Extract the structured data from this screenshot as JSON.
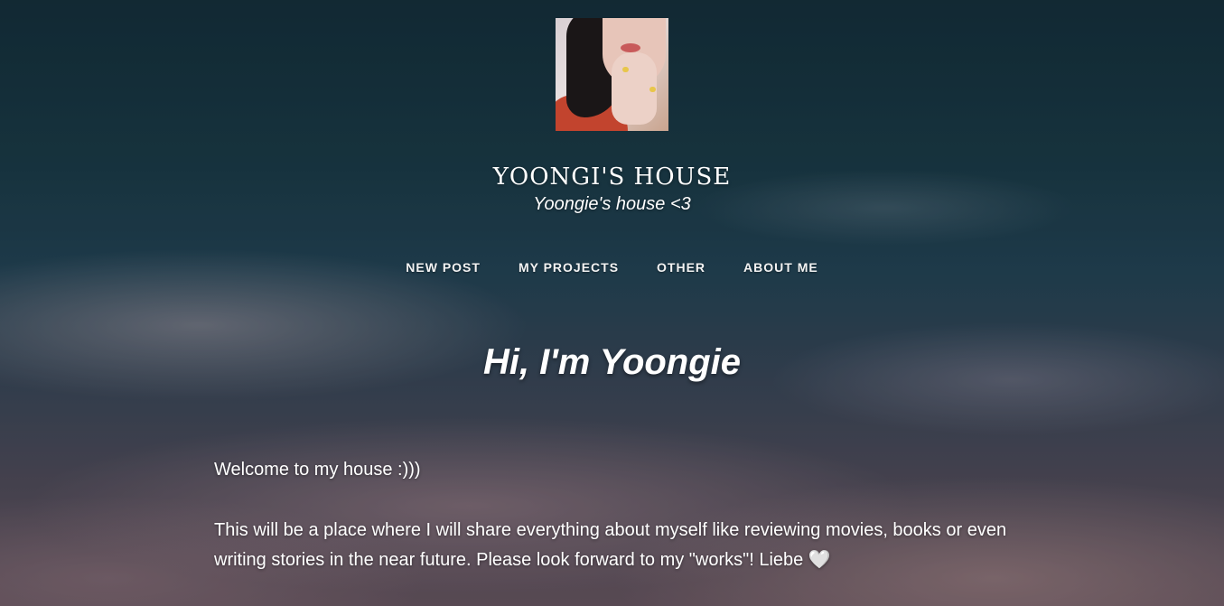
{
  "site": {
    "title": "YOONGI'S HOUSE",
    "description": "Yoongie's house <3"
  },
  "avatar": {
    "name": "profile-photo"
  },
  "nav": {
    "items": [
      {
        "label": "NEW POST"
      },
      {
        "label": "MY PROJECTS"
      },
      {
        "label": "OTHER"
      },
      {
        "label": "ABOUT ME"
      }
    ]
  },
  "main": {
    "headline": "Hi, I'm Yoongie",
    "paragraph1": "Welcome to my house :)))",
    "paragraph2": "This will be a place where I will share everything about myself like reviewing movies, books or even writing stories in the near future. Please look forward to my \"works\"! Liebe",
    "heart": "🤍"
  },
  "colors": {
    "text": "#ffffff",
    "sky_top": "#16323f",
    "sky_bottom": "#6c5a66"
  }
}
